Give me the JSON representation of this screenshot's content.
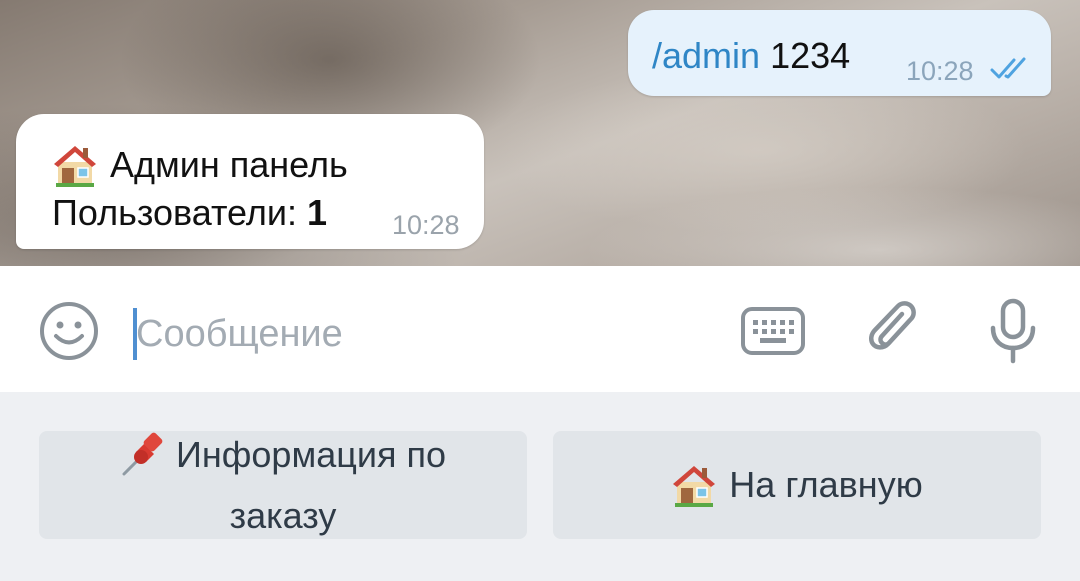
{
  "messages": [
    {
      "direction": "outgoing",
      "command": "/admin",
      "argument": "1234",
      "time": "10:28",
      "status_icon": "double-check-read-icon"
    },
    {
      "direction": "incoming",
      "icon": "house-emoji",
      "title": "Админ панель",
      "users_label": "Пользователи:",
      "users_count": "1",
      "time": "10:28"
    }
  ],
  "composer": {
    "placeholder": "Сообщение",
    "value": "",
    "icons": [
      "smile-icon",
      "keyboard-icon",
      "paperclip-icon",
      "microphone-icon"
    ]
  },
  "reply_keyboard": {
    "buttons": [
      {
        "icon": "pushpin-emoji",
        "line1": "Информация по",
        "line2": "заказу"
      },
      {
        "icon": "house-emoji",
        "label": "На главную"
      }
    ]
  },
  "colors": {
    "outgoing_bubble": "#e6f2fc",
    "command_link": "#2f86c6",
    "read_checks": "#4fa3e0",
    "cursor": "#4f8fd1",
    "keyboard_button": "#e1e5e9",
    "keyboard_background": "#eef0f3"
  }
}
